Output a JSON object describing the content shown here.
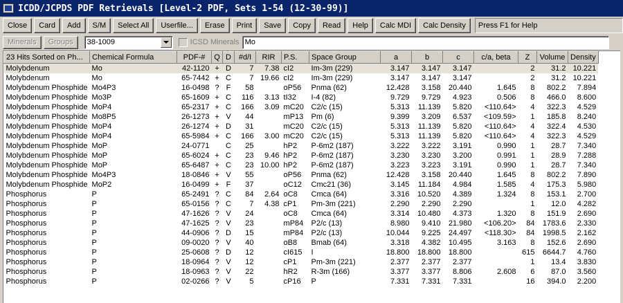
{
  "window": {
    "title": "ICDD/JCPDS PDF Retrievals [Level-2 PDF, Sets 1-54 (12-30-99)]"
  },
  "toolbar": {
    "buttons": [
      {
        "label": "Close"
      },
      {
        "label": "Card"
      },
      {
        "label": "Add"
      },
      {
        "label": "S/M"
      },
      {
        "label": "Select All"
      },
      {
        "label": "Userfile..."
      },
      {
        "label": "Erase"
      },
      {
        "label": "Print"
      },
      {
        "label": "Save"
      },
      {
        "label": "Copy"
      },
      {
        "label": "Read"
      },
      {
        "label": "Help"
      },
      {
        "label": "Calc MDI"
      },
      {
        "label": "Calc Density"
      }
    ],
    "status": "Press F1 for Help"
  },
  "toolbar2": {
    "minerals_label": "Minerals",
    "groups_label": "Groups",
    "card_select_value": "38-1009",
    "icsd_label": "ICSD Minerals",
    "search_value": "Mo"
  },
  "table": {
    "headers": [
      "23 Hits Sorted on Ph...",
      "Chemical Formula",
      "PDF-#",
      "Q",
      "D",
      "#d/I",
      "RIR",
      "P.S.",
      "Space Group",
      "a",
      "b",
      "c",
      "c/a, beta",
      "Z",
      "Volume",
      "Density"
    ],
    "rows": [
      [
        "Molybdenum",
        "Mo",
        "42-1120",
        "+",
        "D",
        "7",
        "7.38",
        "cI2",
        "Im-3m (229)",
        "3.147",
        "3.147",
        "3.147",
        "",
        "2",
        "31.2",
        "10.221"
      ],
      [
        "Molybdenum",
        "Mo",
        "65-7442",
        "+",
        "C",
        "7",
        "19.66",
        "cI2",
        "Im-3m (229)",
        "3.147",
        "3.147",
        "3.147",
        "",
        "2",
        "31.2",
        "10.221"
      ],
      [
        "Molybdenum Phosphide",
        "Mo4P3",
        "16-0498",
        "?",
        "F",
        "58",
        "",
        "oP56",
        "Pnma (62)",
        "12.428",
        "3.158",
        "20.440",
        "1.645",
        "8",
        "802.2",
        "7.894"
      ],
      [
        "Molybdenum Phosphide",
        "Mo3P",
        "65-1609",
        "+",
        "C",
        "116",
        "3.13",
        "tI32",
        "I-4 (82)",
        "9.729",
        "9.729",
        "4.923",
        "0.506",
        "8",
        "466.0",
        "8.600"
      ],
      [
        "Molybdenum Phosphide",
        "MoP4",
        "65-2317",
        "+",
        "C",
        "166",
        "3.09",
        "mC20",
        "C2/c (15)",
        "5.313",
        "11.139",
        "5.820",
        "<110.64>",
        "4",
        "322.3",
        "4.529"
      ],
      [
        "Molybdenum Phosphide",
        "Mo8P5",
        "26-1273",
        "+",
        "V",
        "44",
        "",
        "mP13",
        "Pm (6)",
        "9.399",
        "3.209",
        "6.537",
        "<109.59>",
        "1",
        "185.8",
        "8.240"
      ],
      [
        "Molybdenum Phosphide",
        "MoP4",
        "26-1274",
        "+",
        "D",
        "31",
        "",
        "mC20",
        "C2/c (15)",
        "5.313",
        "11.139",
        "5.820",
        "<110.64>",
        "4",
        "322.4",
        "4.530"
      ],
      [
        "Molybdenum Phosphide",
        "MoP4",
        "65-5984",
        "+",
        "C",
        "166",
        "3.00",
        "mC20",
        "C2/c (15)",
        "5.313",
        "11.139",
        "5.820",
        "<110.64>",
        "4",
        "322.3",
        "4.529"
      ],
      [
        "Molybdenum Phosphide",
        "MoP",
        "24-0771",
        "",
        "C",
        "25",
        "",
        "hP2",
        "P-6m2 (187)",
        "3.222",
        "3.222",
        "3.191",
        "0.990",
        "1",
        "28.7",
        "7.340"
      ],
      [
        "Molybdenum Phosphide",
        "MoP",
        "65-6024",
        "+",
        "C",
        "23",
        "9.46",
        "hP2",
        "P-6m2 (187)",
        "3.230",
        "3.230",
        "3.200",
        "0.991",
        "1",
        "28.9",
        "7.288"
      ],
      [
        "Molybdenum Phosphide",
        "MoP",
        "65-6487",
        "+",
        "C",
        "23",
        "10.00",
        "hP2",
        "P-6m2 (187)",
        "3.223",
        "3.223",
        "3.191",
        "0.990",
        "1",
        "28.7",
        "7.340"
      ],
      [
        "Molybdenum Phosphide",
        "Mo4P3",
        "18-0846",
        "+",
        "V",
        "55",
        "",
        "oP56",
        "Pnma (62)",
        "12.428",
        "3.158",
        "20.440",
        "1.645",
        "8",
        "802.2",
        "7.890"
      ],
      [
        "Molybdenum Phosphide",
        "MoP2",
        "16-0499",
        "+",
        "F",
        "37",
        "",
        "oC12",
        "Cmc21 (36)",
        "3.145",
        "11.184",
        "4.984",
        "1.585",
        "4",
        "175.3",
        "5.980"
      ],
      [
        "Phosphorus",
        "P",
        "65-2491",
        "?",
        "C",
        "84",
        "2.64",
        "oC8",
        "Cmca (64)",
        "3.316",
        "10.520",
        "4.389",
        "1.324",
        "8",
        "153.1",
        "2.700"
      ],
      [
        "Phosphorus",
        "P",
        "65-0156",
        "?",
        "C",
        "7",
        "4.38",
        "cP1",
        "Pm-3m (221)",
        "2.290",
        "2.290",
        "2.290",
        "",
        "1",
        "12.0",
        "4.282"
      ],
      [
        "Phosphorus",
        "P",
        "47-1626",
        "?",
        "V",
        "24",
        "",
        "oC8",
        "Cmca (64)",
        "3.314",
        "10.480",
        "4.373",
        "1.320",
        "8",
        "151.9",
        "2.690"
      ],
      [
        "Phosphorus",
        "P",
        "47-1625",
        "?",
        "V",
        "23",
        "",
        "mP84",
        "P2/c (13)",
        "8.980",
        "9.410",
        "21.980",
        "<106.20>",
        "84",
        "1783.6",
        "2.330"
      ],
      [
        "Phosphorus",
        "P",
        "44-0906",
        "?",
        "D",
        "15",
        "",
        "mP84",
        "P2/c (13)",
        "10.044",
        "9.225",
        "24.497",
        "<118.30>",
        "84",
        "1998.5",
        "2.162"
      ],
      [
        "Phosphorus",
        "P",
        "09-0020",
        "?",
        "V",
        "40",
        "",
        "oB8",
        "Bmab (64)",
        "3.318",
        "4.382",
        "10.495",
        "3.163",
        "8",
        "152.6",
        "2.690"
      ],
      [
        "Phosphorus",
        "P",
        "25-0608",
        "?",
        "D",
        "12",
        "",
        "cI615",
        "I",
        "18.800",
        "18.800",
        "18.800",
        "",
        "615",
        "6644.7",
        "4.760"
      ],
      [
        "Phosphorus",
        "P",
        "18-0964",
        "?",
        "V",
        "12",
        "",
        "cP1",
        "Pm-3m (221)",
        "2.377",
        "2.377",
        "2.377",
        "",
        "1",
        "13.4",
        "3.830"
      ],
      [
        "Phosphorus",
        "P",
        "18-0963",
        "?",
        "V",
        "22",
        "",
        "hR2",
        "R-3m (166)",
        "3.377",
        "3.377",
        "8.806",
        "2.608",
        "6",
        "87.0",
        "3.560"
      ],
      [
        "Phosphorus",
        "P",
        "02-0266",
        "?",
        "V",
        "5",
        "",
        "cP16",
        "P",
        "7.331",
        "7.331",
        "7.331",
        "",
        "16",
        "394.0",
        "2.200"
      ]
    ]
  }
}
